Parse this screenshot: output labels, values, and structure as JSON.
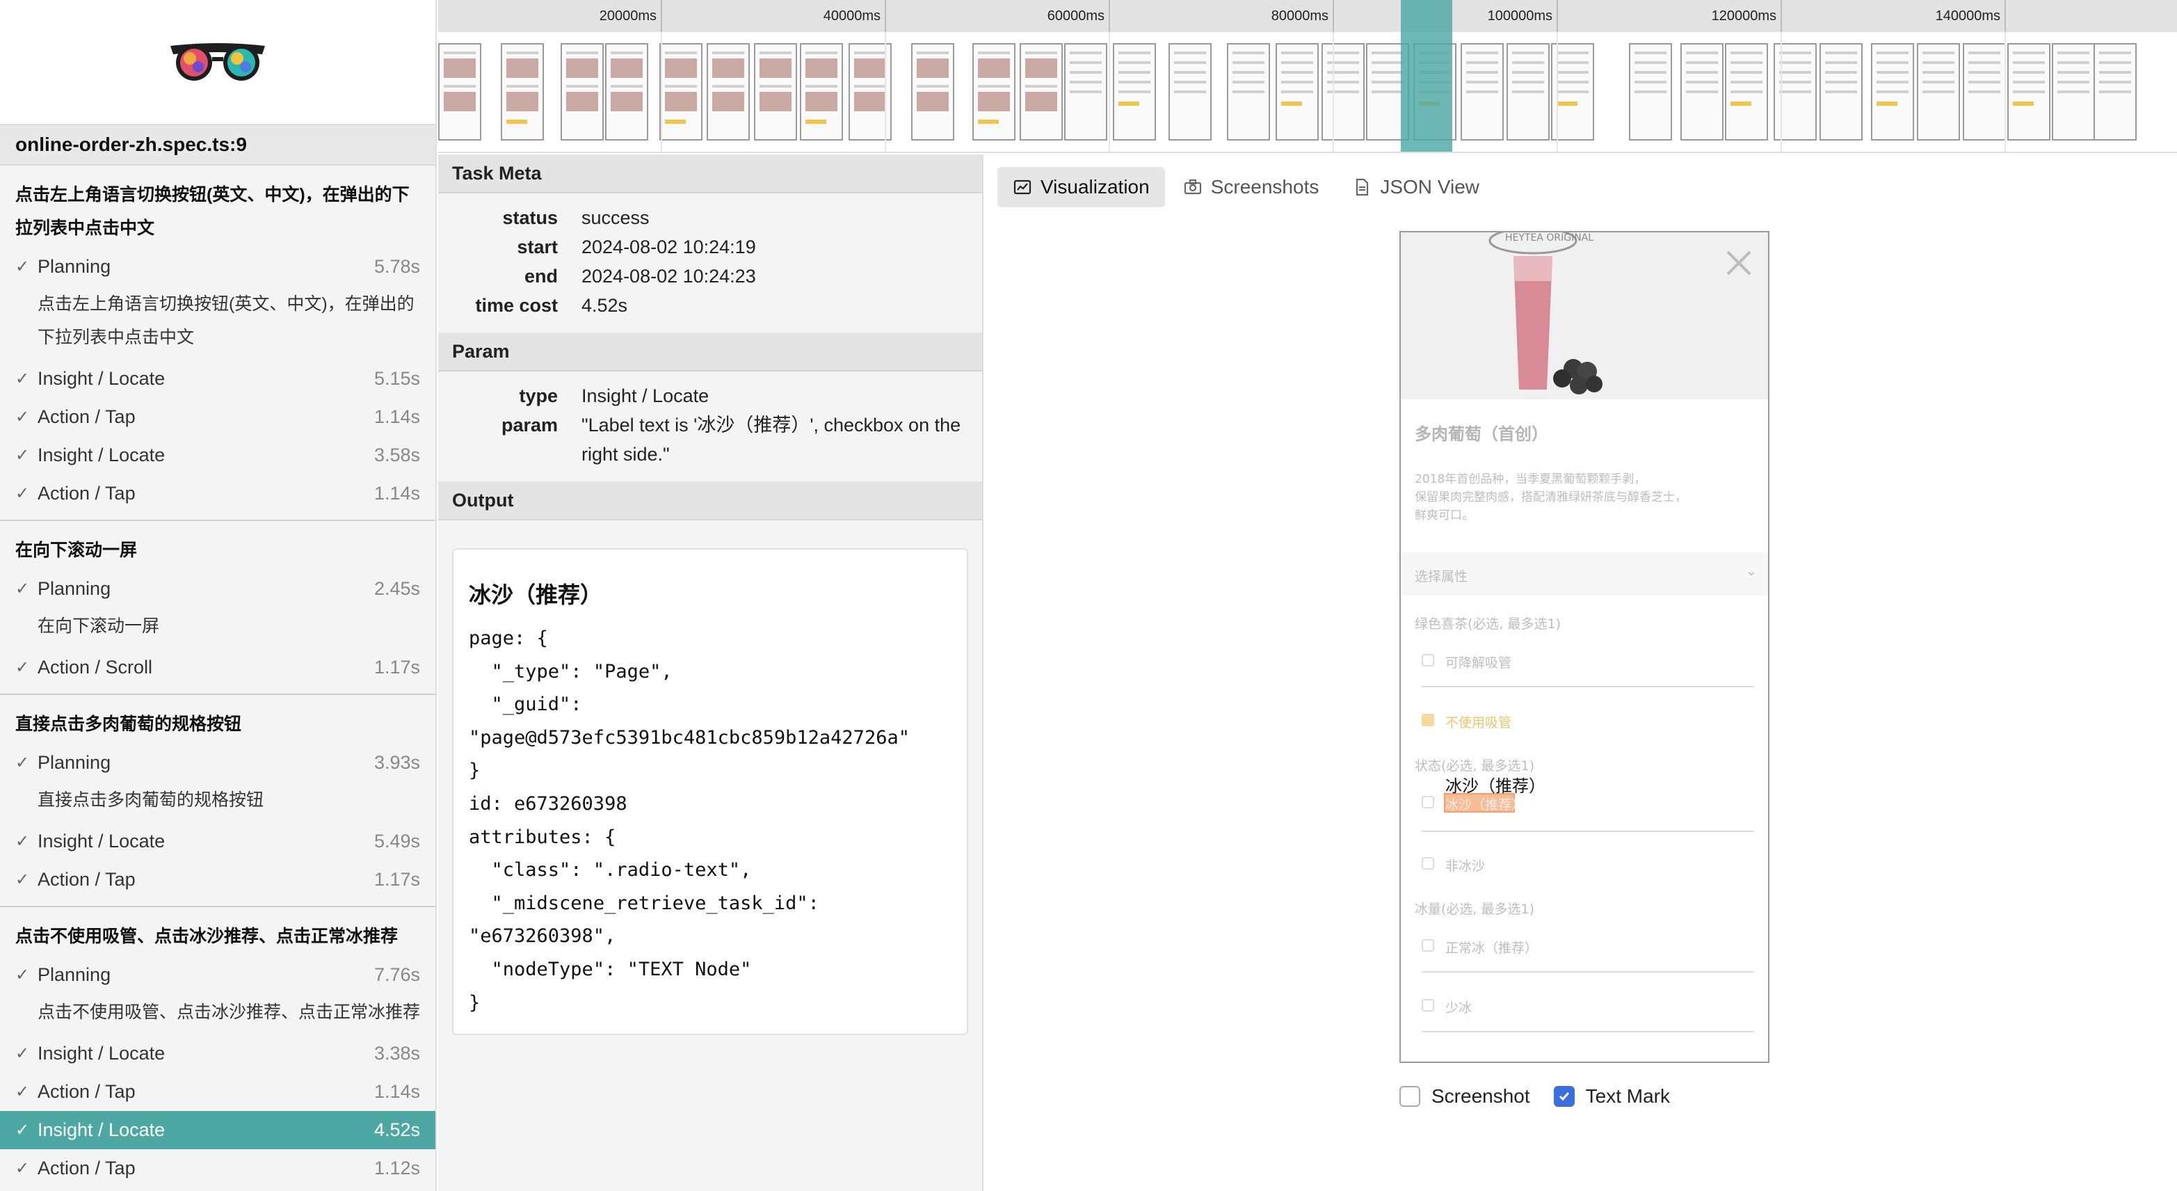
{
  "sidebar": {
    "spec_title": "online-order-zh.spec.ts:9",
    "groups": [
      {
        "title": "点击左上角语言切换按钮(英文、中文)，在弹出的下拉列表中点击中文",
        "tasks": [
          {
            "check": "✓",
            "name": "Planning",
            "time": "5.78s",
            "sub": "点击左上角语言切换按钮(英文、中文)，在弹出的下拉列表中点击中文"
          },
          {
            "check": "✓",
            "name": "Insight / Locate",
            "time": "5.15s"
          },
          {
            "check": "✓",
            "name": "Action / Tap",
            "time": "1.14s"
          },
          {
            "check": "✓",
            "name": "Insight / Locate",
            "time": "3.58s"
          },
          {
            "check": "✓",
            "name": "Action / Tap",
            "time": "1.14s"
          }
        ]
      },
      {
        "title": "在向下滚动一屏",
        "tasks": [
          {
            "check": "✓",
            "name": "Planning",
            "time": "2.45s",
            "sub": "在向下滚动一屏"
          },
          {
            "check": "✓",
            "name": "Action / Scroll",
            "time": "1.17s"
          }
        ]
      },
      {
        "title": "直接点击多肉葡萄的规格按钮",
        "tasks": [
          {
            "check": "✓",
            "name": "Planning",
            "time": "3.93s",
            "sub": "直接点击多肉葡萄的规格按钮"
          },
          {
            "check": "✓",
            "name": "Insight / Locate",
            "time": "5.49s"
          },
          {
            "check": "✓",
            "name": "Action / Tap",
            "time": "1.17s"
          }
        ]
      },
      {
        "title": "点击不使用吸管、点击冰沙推荐、点击正常冰推荐",
        "tasks": [
          {
            "check": "✓",
            "name": "Planning",
            "time": "7.76s",
            "sub": "点击不使用吸管、点击冰沙推荐、点击正常冰推荐"
          },
          {
            "check": "✓",
            "name": "Insight / Locate",
            "time": "3.38s"
          },
          {
            "check": "✓",
            "name": "Action / Tap",
            "time": "1.14s"
          },
          {
            "check": "✓",
            "name": "Insight / Locate",
            "time": "4.52s",
            "selected": true
          },
          {
            "check": "✓",
            "name": "Action / Tap",
            "time": "1.12s"
          }
        ]
      }
    ]
  },
  "timeline": {
    "ticks": [
      "20000ms",
      "40000ms",
      "60000ms",
      "80000ms",
      "100000ms",
      "120000ms",
      "140000ms"
    ]
  },
  "task_meta": {
    "header": "Task Meta",
    "status_label": "status",
    "status": "success",
    "start_label": "start",
    "start": "2024-08-02 10:24:19",
    "end_label": "end",
    "end": "2024-08-02 10:24:23",
    "cost_label": "time cost",
    "cost": "4.52s"
  },
  "param": {
    "header": "Param",
    "type_label": "type",
    "type": "Insight / Locate",
    "param_label": "param",
    "param": "\"Label text is '冰沙（推荐）', checkbox on the right side.\""
  },
  "output": {
    "header": "Output",
    "title": "冰沙（推荐）",
    "code": "page: {\n  \"_type\": \"Page\",\n  \"_guid\":\n\"page@d573efc5391bc481cbc859b12a42726a\"\n}\nid: e673260398\nattributes: {\n  \"class\": \".radio-text\",\n  \"_midscene_retrieve_task_id\":\n\"e673260398\",\n  \"nodeType\": \"TEXT Node\"\n}"
  },
  "view_tabs": {
    "visualization": "Visualization",
    "screenshots": "Screenshots",
    "json": "JSON View"
  },
  "preview": {
    "badge": "HEYTEA ORIGINAL",
    "product_name": "多肉葡萄（首创）",
    "desc_1": "2018年首创品种，当季夏黑葡萄颗颗手剥，",
    "desc_2": "保留果肉完整肉感，搭配清雅绿妍茶底与醇香芝士，",
    "desc_3": "鲜爽可口。",
    "attr_header": "选择属性",
    "straw_group": "绿色喜茶(必选, 最多选1)",
    "straw_opt1": "可降解吸管",
    "straw_opt2": "不使用吸管",
    "state_group": "状态(必选, 最多选1)",
    "state_opt1": "冰沙（推荐）",
    "state_opt2": "非冰沙",
    "ice_group": "冰量(必选, 最多选1)",
    "ice_opt1": "正常冰（推荐）",
    "ice_opt2": "少冰",
    "element_label": "冰沙（推荐）"
  },
  "toggles": {
    "screenshot_label": "Screenshot",
    "screenshot_checked": false,
    "textmark_label": "Text Mark",
    "textmark_checked": true
  },
  "colors": {
    "accent": "#4da8a4",
    "highlight_box": "#f5a06a",
    "checkbox_on": "#3b6fe0"
  }
}
